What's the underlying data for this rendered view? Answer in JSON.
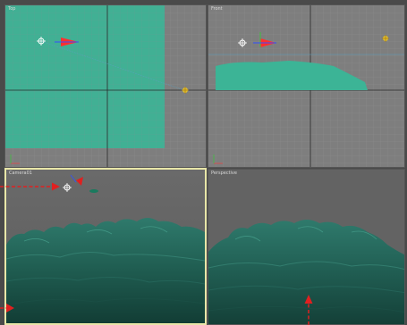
{
  "viewports": {
    "top": {
      "label": "Top"
    },
    "front": {
      "label": "Front"
    },
    "camera": {
      "label": "Camera01"
    },
    "perspective": {
      "label": "Perspective"
    }
  },
  "colors": {
    "terrain": "#3cb496",
    "active_border": "#e8e6a8",
    "annotation_arrow": "#e02020"
  },
  "icons": [
    "camera-icon",
    "light-icon",
    "target-icon",
    "axis-tripod-icon"
  ]
}
